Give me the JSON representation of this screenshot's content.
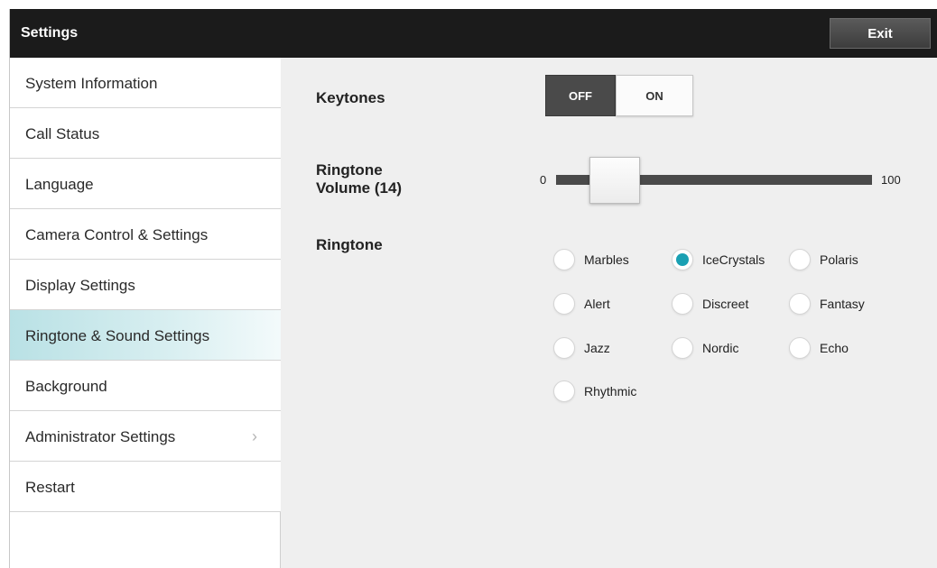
{
  "header": {
    "title": "Settings",
    "exit_label": "Exit"
  },
  "sidebar": {
    "items": [
      {
        "label": "System Information",
        "selected": false,
        "has_chevron": false
      },
      {
        "label": "Call Status",
        "selected": false,
        "has_chevron": false
      },
      {
        "label": "Language",
        "selected": false,
        "has_chevron": false
      },
      {
        "label": "Camera Control & Settings",
        "selected": false,
        "has_chevron": false
      },
      {
        "label": "Display Settings",
        "selected": false,
        "has_chevron": false
      },
      {
        "label": "Ringtone & Sound Settings",
        "selected": true,
        "has_chevron": false
      },
      {
        "label": "Background",
        "selected": false,
        "has_chevron": false
      },
      {
        "label": "Administrator Settings",
        "selected": false,
        "has_chevron": true,
        "chevron_icon": "chevron-right-icon"
      },
      {
        "label": "Restart",
        "selected": false,
        "has_chevron": false
      }
    ]
  },
  "keytones": {
    "label": "Keytones",
    "off_label": "OFF",
    "on_label": "ON",
    "value": "OFF"
  },
  "volume": {
    "label_line1": "Ringtone",
    "label_line2": "Volume (14)",
    "min_label": "0",
    "max_label": "100",
    "min": 0,
    "max": 100,
    "value": 14
  },
  "ringtone": {
    "label": "Ringtone",
    "selected": "IceCrystals",
    "options": [
      "Marbles",
      "IceCrystals",
      "Polaris",
      "Alert",
      "Discreet",
      "Fantasy",
      "Jazz",
      "Nordic",
      "Echo",
      "Rhythmic"
    ]
  },
  "colors": {
    "header_bg": "#1b1b1b",
    "accent": "#1aa0b3",
    "selected_item_bg": "#b9e1e5",
    "track": "#4a4a4a"
  }
}
